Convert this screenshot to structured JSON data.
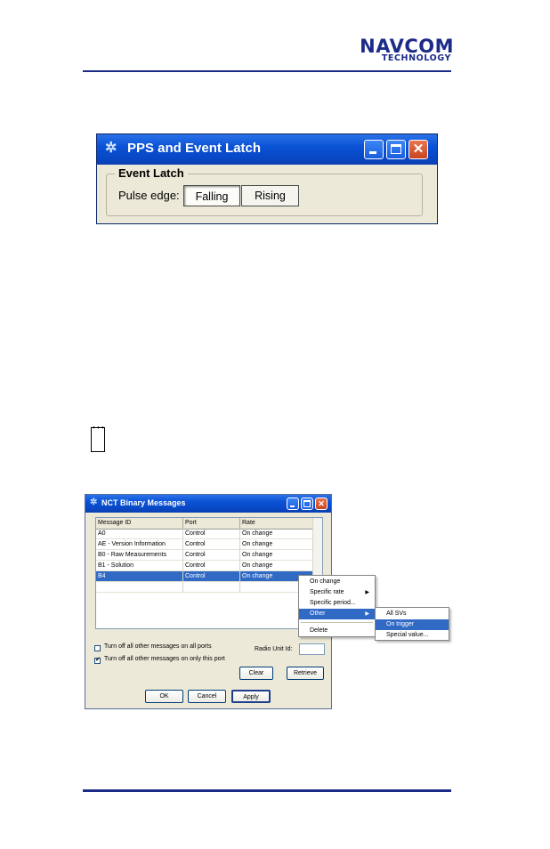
{
  "header": {
    "logo_main": "NAVCOM",
    "logo_sub": "TECHNOLOGY"
  },
  "pps_window": {
    "title": "PPS and Event Latch",
    "group_title": "Event Latch",
    "pulse_label": "Pulse edge:",
    "falling_label": "Falling",
    "rising_label": "Rising",
    "selected": "Falling"
  },
  "note_icon": "notepad-icon",
  "nct_window": {
    "title": "NCT Binary Messages",
    "columns": [
      "Message ID",
      "Port",
      "Rate"
    ],
    "rows": [
      [
        "A0",
        "Control",
        "On change"
      ],
      [
        "AE - Version Information",
        "Control",
        "On change"
      ],
      [
        "B0 - Raw Measurements",
        "Control",
        "On change"
      ],
      [
        "B1 - Solution",
        "Control",
        "On change"
      ],
      [
        "B4",
        "Control",
        "On change"
      ]
    ],
    "selected_row": 4,
    "check_all_ports": "Turn off all other messages on all ports",
    "check_all_ports_checked": false,
    "check_this_port": "Turn off all other messages on only this port",
    "check_this_port_checked": true,
    "radio_unit_label": "Radio Unit Id:",
    "clear_label": "Clear",
    "retrieve_label": "Retrieve",
    "ok_label": "OK",
    "cancel_label": "Cancel",
    "apply_label": "Apply"
  },
  "context_menu": {
    "items": [
      "On change",
      "Specific rate",
      "Specific period...",
      "Other",
      "Delete"
    ],
    "highlighted": "Other"
  },
  "submenu": {
    "items": [
      "All SVs",
      "On trigger",
      "Special value..."
    ],
    "highlighted": "On trigger"
  },
  "colors": {
    "brand": "#1c2a88",
    "selection": "#316ac5",
    "xp_title": "#0a52d5",
    "dialog_bg": "#ece9d8"
  }
}
